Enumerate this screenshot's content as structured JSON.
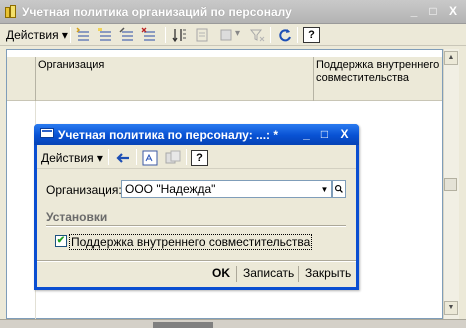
{
  "outer_window": {
    "title": "Учетная политика организаций по персоналу",
    "buttons": {
      "minimize": "_",
      "maximize": "□",
      "close": "X"
    },
    "toolbar": {
      "actions_menu": "Действия",
      "dropdown_arrow": "▾",
      "help": "?"
    },
    "table": {
      "columns": [
        "Организация",
        "Поддержка внутреннего совместительства"
      ]
    },
    "scrollbar": {
      "up": "▲",
      "down": "▼"
    }
  },
  "dialog": {
    "title": "Учетная политика по персоналу: ...: *",
    "buttons": {
      "minimize": "_",
      "maximize": "□",
      "close": "X"
    },
    "toolbar": {
      "actions_menu": "Действия",
      "dropdown_arrow": "▾",
      "help": "?"
    },
    "organization_label": "Организация:",
    "organization_value": "ООО \"Надежда\"",
    "organization_drop": "▼",
    "group_title": "Установки",
    "checkbox_label": "Поддержка внутреннего совместительства",
    "checkbox_checked": true,
    "checkbox_mark": "✔",
    "ok_button": "OK",
    "save_button": "Записать",
    "close_button": "Закрыть"
  },
  "colors": {
    "dialog_title": "#0851d3",
    "window_bg": "#ece9d8",
    "inactive_title": "#b3b3b3"
  }
}
